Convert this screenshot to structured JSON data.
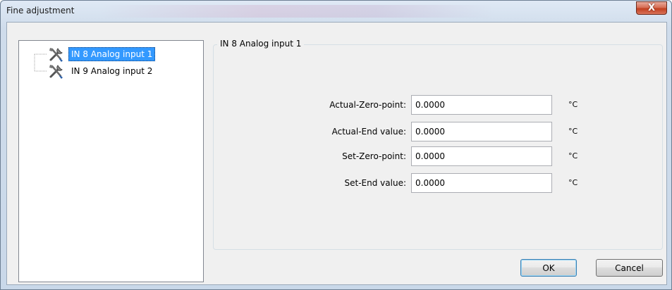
{
  "window": {
    "title": "Fine adjustment",
    "close_glyph": "X"
  },
  "tree": {
    "items": [
      {
        "label": "IN 8 Analog input 1",
        "icon": "tools-icon",
        "selected": true
      },
      {
        "label": "IN 9 Analog input 2",
        "icon": "tools-icon",
        "selected": false
      }
    ]
  },
  "group": {
    "title": "IN 8 Analog input 1",
    "fields": [
      {
        "label": "Actual-Zero-point:",
        "value": "0.0000",
        "unit": "°C"
      },
      {
        "label": "Actual-End value:",
        "value": "0.0000",
        "unit": "°C"
      },
      {
        "label": "Set-Zero-point:",
        "value": "0.0000",
        "unit": "°C"
      },
      {
        "label": "Set-End value:",
        "value": "0.0000",
        "unit": "°C"
      }
    ]
  },
  "buttons": {
    "ok_label": "OK",
    "cancel_label": "Cancel"
  },
  "colors": {
    "selection": "#3399ff",
    "close_button": "#c23f20"
  }
}
